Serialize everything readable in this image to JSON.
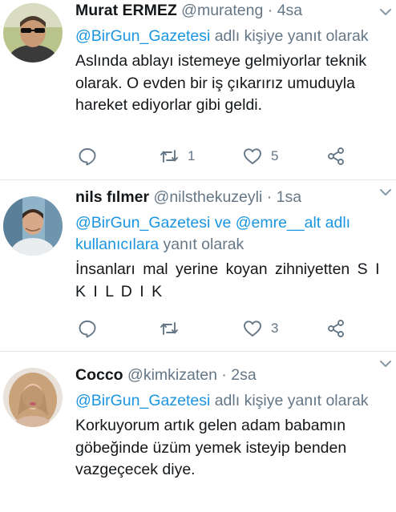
{
  "tweets": [
    {
      "name": "Murat ERMEZ",
      "handle": "@murateng",
      "separator": "·",
      "time": "4sa",
      "reply_prefix": "",
      "reply_mentions": "@BirGun_Gazetesi",
      "reply_suffix": " adlı kişiye yanıt olarak",
      "text": "Aslında ablayı istemeye gelmiyorlar teknik olarak. O evden bir iş çıkarırız umuduyla hareket ediyorlar gibi geldi.",
      "retweets": "1",
      "likes": "5"
    },
    {
      "name": "nils fılmer",
      "handle": "@nilsthekuzeyli",
      "separator": "·",
      "time": "1sa",
      "reply_mentions": "@BirGun_Gazetesi ve @emre__alt adlı kullanıcılara",
      "reply_suffix": " yanıt olarak",
      "text": "İnsanları mal yerine koyan zihniyetten S I K I L D I K",
      "retweets": "",
      "likes": "3"
    },
    {
      "name": "Cocco",
      "handle": "@kimkizaten",
      "separator": "·",
      "time": "2sa",
      "reply_mentions": "@BirGun_Gazetesi",
      "reply_suffix": " adlı kişiye yanıt olarak",
      "text": "Korkuyorum artık gelen adam babamın göbeğinde üzüm yemek isteyip benden vazgeçecek diye."
    }
  ],
  "colors": {
    "link": "#1b95e0",
    "secondary": "#657786",
    "primary": "#14171a",
    "divider": "#e1e8ed"
  },
  "icons": [
    "reply-icon",
    "retweet-icon",
    "like-icon",
    "share-icon",
    "caret-down-icon"
  ]
}
